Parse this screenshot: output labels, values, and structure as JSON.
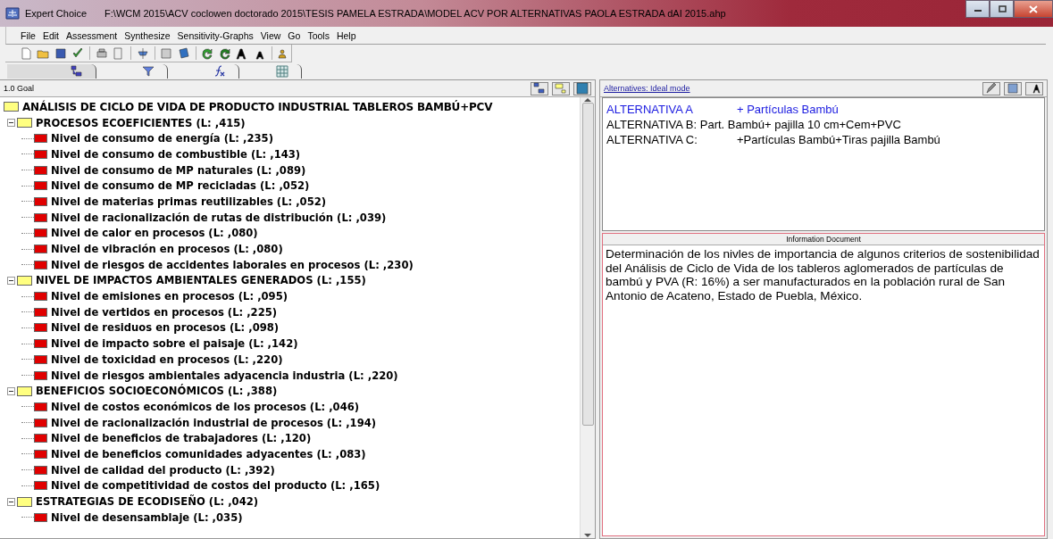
{
  "window": {
    "app": "Expert Choice",
    "path": "F:\\WCM 2015\\ACV coclowen doctorado 2015\\TESIS PAMELA ESTRADA\\MODEL ACV POR ALTERNATIVAS PAOLA ESTRADA dAI 2015.ahp"
  },
  "menu": [
    {
      "label": "File"
    },
    {
      "label": "Edit"
    },
    {
      "label": "Assessment"
    },
    {
      "label": "Synthesize"
    },
    {
      "label": "Sensitivity-Graphs"
    },
    {
      "label": "View"
    },
    {
      "label": "Go"
    },
    {
      "label": "Tools"
    },
    {
      "label": "Help"
    }
  ],
  "tabs": [
    {
      "kind": "tree",
      "selected": true
    },
    {
      "kind": "filter",
      "selected": false
    },
    {
      "kind": "formula",
      "selected": false
    },
    {
      "kind": "grid",
      "selected": false
    }
  ],
  "left_pane": {
    "header": "1.0 Goal",
    "tree": [
      {
        "label": "ANÁLISIS DE CICLO DE VIDA DE PRODUCTO INDUSTRIAL TABLEROS BAMBÚ+PCV",
        "children": [
          {
            "label": "PROCESOS ECOEFICIENTES (L: ,415)",
            "expanded": true,
            "children": [
              {
                "label": "Nivel de consumo de energía (L: ,235)"
              },
              {
                "label": "Nivel de consumo de combustible (L: ,143)"
              },
              {
                "label": "Nivel de consumo de MP naturales (L: ,089)"
              },
              {
                "label": "Nivel de consumo de MP recicladas (L: ,052)"
              },
              {
                "label": "Nivel de materias primas reutilizables (L: ,052)"
              },
              {
                "label": "Nivel de racionalización de rutas de distribución (L: ,039)"
              },
              {
                "label": "Nivel de calor en procesos (L: ,080)"
              },
              {
                "label": "Nivel de vibración en procesos (L: ,080)"
              },
              {
                "label": "Nivel de riesgos de accidentes laborales en procesos (L: ,230)"
              }
            ]
          },
          {
            "label": "NIVEL DE IMPACTOS AMBIENTALES GENERADOS (L: ,155)",
            "expanded": true,
            "children": [
              {
                "label": "Nivel de emisiones en procesos (L: ,095)"
              },
              {
                "label": "Nivel de vertidos en procesos (L: ,225)"
              },
              {
                "label": "Nivel de residuos en procesos (L: ,098)"
              },
              {
                "label": "Nivel de impacto sobre el paisaje (L: ,142)"
              },
              {
                "label": "Nivel de toxicidad en procesos (L: ,220)"
              },
              {
                "label": "Nivel de riesgos ambientales adyacencia industria (L: ,220)"
              }
            ]
          },
          {
            "label": "BENEFICIOS SOCIOECONÓMICOS (L: ,388)",
            "expanded": true,
            "children": [
              {
                "label": "Nivel de costos económicos de los procesos (L: ,046)"
              },
              {
                "label": "Nivel de racionalización industrial de procesos (L: ,194)"
              },
              {
                "label": "Nivel de beneficios de trabajadores (L: ,120)"
              },
              {
                "label": "Nivel de beneficios comunidades adyacentes (L: ,083)"
              },
              {
                "label": "Nivel de calidad del producto (L: ,392)"
              },
              {
                "label": "Nivel de competitividad de costos del producto (L: ,165)"
              }
            ]
          },
          {
            "label": "ESTRATEGIAS DE ECODISEÑO (L: ,042)",
            "expanded": true,
            "children": [
              {
                "label": "Nivel de desensamblaje (L: ,035)"
              }
            ]
          }
        ]
      }
    ]
  },
  "right_pane": {
    "header": "Alternatives: Ideal mode",
    "alternatives": [
      {
        "label": "ALTERNATIVA A",
        "detail": "+ Partículas Bambú",
        "selected": true
      },
      {
        "label": "ALTERNATIVA B: Part. Bambú+ pajilla 10 cm+Cem+PVC",
        "selected": false
      },
      {
        "label": "ALTERNATIVA C:",
        "detail": "+Partículas Bambú+Tiras pajilla Bambú",
        "selected": false
      }
    ],
    "info_title": "Information Document",
    "info_text": "Determinación de los nivles de importancia de algunos criterios de sostenibilidad del Análisis de Ciclo de Vida de los tableros aglomerados de partículas de bambú y PVA (R: 16%) a ser manufacturados en la población rural de San Antonio de Acateno, Estado de Puebla, México."
  }
}
